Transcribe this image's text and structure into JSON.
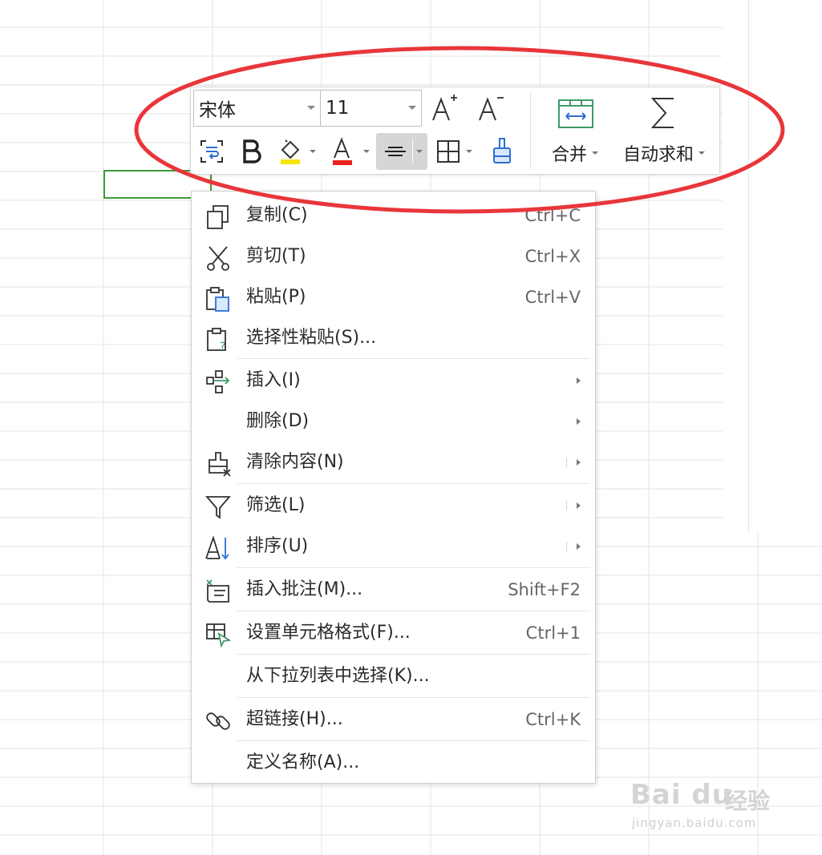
{
  "toolbar": {
    "font_name": "宋体",
    "font_size": "11",
    "merge_label": "合并",
    "autosum_label": "自动求和"
  },
  "menu": {
    "items": [
      {
        "label": "复制(C)",
        "shortcut": "Ctrl+C",
        "icon": "copy-icon"
      },
      {
        "label": "剪切(T)",
        "shortcut": "Ctrl+X",
        "icon": "cut-icon"
      },
      {
        "label": "粘贴(P)",
        "shortcut": "Ctrl+V",
        "icon": "paste-icon"
      },
      {
        "label": "选择性粘贴(S)...",
        "shortcut": "",
        "icon": "paste-special-icon"
      },
      {
        "label": "插入(I)",
        "shortcut": "",
        "icon": "insert-icon"
      },
      {
        "label": "删除(D)",
        "shortcut": "",
        "icon": ""
      },
      {
        "label": "清除内容(N)",
        "shortcut": "",
        "icon": "clear-icon"
      },
      {
        "label": "筛选(L)",
        "shortcut": "",
        "icon": "filter-icon"
      },
      {
        "label": "排序(U)",
        "shortcut": "",
        "icon": "sort-icon"
      },
      {
        "label": "插入批注(M)...",
        "shortcut": "Shift+F2",
        "icon": "comment-icon"
      },
      {
        "label": "设置单元格格式(F)...",
        "shortcut": "Ctrl+1",
        "icon": "format-cells-icon"
      },
      {
        "label": "从下拉列表中选择(K)...",
        "shortcut": "",
        "icon": ""
      },
      {
        "label": "超链接(H)...",
        "shortcut": "Ctrl+K",
        "icon": "link-icon"
      },
      {
        "label": "定义名称(A)...",
        "shortcut": "",
        "icon": ""
      }
    ]
  },
  "colors": {
    "annotation": "#e8363a",
    "selection": "#3f9a3a",
    "highlight_yellow": "#f5e600",
    "font_red": "#e8231f",
    "merge_green": "#3f9a6a"
  },
  "watermark": {
    "brand": "Bai du",
    "cn": "经验",
    "url": "jingyan.baidu.com"
  }
}
